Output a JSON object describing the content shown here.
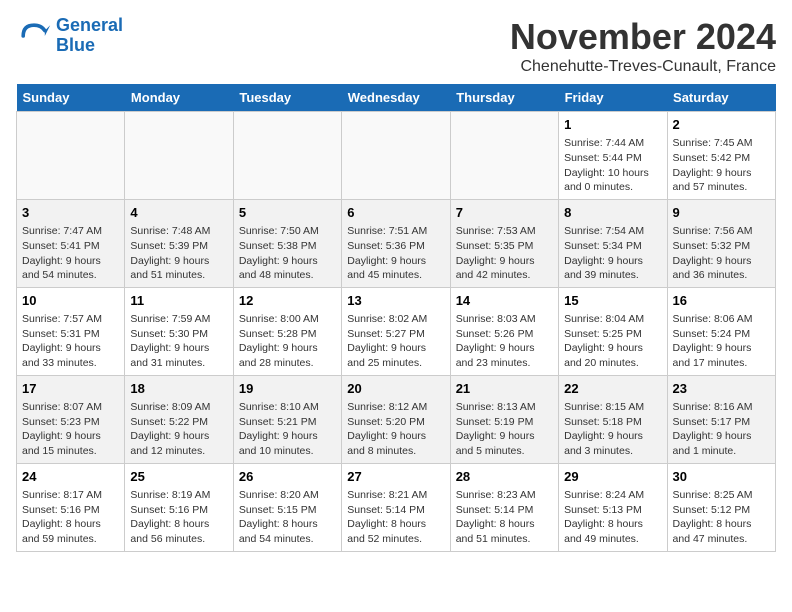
{
  "header": {
    "logo_line1": "General",
    "logo_line2": "Blue",
    "month": "November 2024",
    "location": "Chenehutte-Treves-Cunault, France"
  },
  "weekdays": [
    "Sunday",
    "Monday",
    "Tuesday",
    "Wednesday",
    "Thursday",
    "Friday",
    "Saturday"
  ],
  "weeks": [
    [
      {
        "day": "",
        "info": ""
      },
      {
        "day": "",
        "info": ""
      },
      {
        "day": "",
        "info": ""
      },
      {
        "day": "",
        "info": ""
      },
      {
        "day": "",
        "info": ""
      },
      {
        "day": "1",
        "info": "Sunrise: 7:44 AM\nSunset: 5:44 PM\nDaylight: 10 hours\nand 0 minutes."
      },
      {
        "day": "2",
        "info": "Sunrise: 7:45 AM\nSunset: 5:42 PM\nDaylight: 9 hours\nand 57 minutes."
      }
    ],
    [
      {
        "day": "3",
        "info": "Sunrise: 7:47 AM\nSunset: 5:41 PM\nDaylight: 9 hours\nand 54 minutes."
      },
      {
        "day": "4",
        "info": "Sunrise: 7:48 AM\nSunset: 5:39 PM\nDaylight: 9 hours\nand 51 minutes."
      },
      {
        "day": "5",
        "info": "Sunrise: 7:50 AM\nSunset: 5:38 PM\nDaylight: 9 hours\nand 48 minutes."
      },
      {
        "day": "6",
        "info": "Sunrise: 7:51 AM\nSunset: 5:36 PM\nDaylight: 9 hours\nand 45 minutes."
      },
      {
        "day": "7",
        "info": "Sunrise: 7:53 AM\nSunset: 5:35 PM\nDaylight: 9 hours\nand 42 minutes."
      },
      {
        "day": "8",
        "info": "Sunrise: 7:54 AM\nSunset: 5:34 PM\nDaylight: 9 hours\nand 39 minutes."
      },
      {
        "day": "9",
        "info": "Sunrise: 7:56 AM\nSunset: 5:32 PM\nDaylight: 9 hours\nand 36 minutes."
      }
    ],
    [
      {
        "day": "10",
        "info": "Sunrise: 7:57 AM\nSunset: 5:31 PM\nDaylight: 9 hours\nand 33 minutes."
      },
      {
        "day": "11",
        "info": "Sunrise: 7:59 AM\nSunset: 5:30 PM\nDaylight: 9 hours\nand 31 minutes."
      },
      {
        "day": "12",
        "info": "Sunrise: 8:00 AM\nSunset: 5:28 PM\nDaylight: 9 hours\nand 28 minutes."
      },
      {
        "day": "13",
        "info": "Sunrise: 8:02 AM\nSunset: 5:27 PM\nDaylight: 9 hours\nand 25 minutes."
      },
      {
        "day": "14",
        "info": "Sunrise: 8:03 AM\nSunset: 5:26 PM\nDaylight: 9 hours\nand 23 minutes."
      },
      {
        "day": "15",
        "info": "Sunrise: 8:04 AM\nSunset: 5:25 PM\nDaylight: 9 hours\nand 20 minutes."
      },
      {
        "day": "16",
        "info": "Sunrise: 8:06 AM\nSunset: 5:24 PM\nDaylight: 9 hours\nand 17 minutes."
      }
    ],
    [
      {
        "day": "17",
        "info": "Sunrise: 8:07 AM\nSunset: 5:23 PM\nDaylight: 9 hours\nand 15 minutes."
      },
      {
        "day": "18",
        "info": "Sunrise: 8:09 AM\nSunset: 5:22 PM\nDaylight: 9 hours\nand 12 minutes."
      },
      {
        "day": "19",
        "info": "Sunrise: 8:10 AM\nSunset: 5:21 PM\nDaylight: 9 hours\nand 10 minutes."
      },
      {
        "day": "20",
        "info": "Sunrise: 8:12 AM\nSunset: 5:20 PM\nDaylight: 9 hours\nand 8 minutes."
      },
      {
        "day": "21",
        "info": "Sunrise: 8:13 AM\nSunset: 5:19 PM\nDaylight: 9 hours\nand 5 minutes."
      },
      {
        "day": "22",
        "info": "Sunrise: 8:15 AM\nSunset: 5:18 PM\nDaylight: 9 hours\nand 3 minutes."
      },
      {
        "day": "23",
        "info": "Sunrise: 8:16 AM\nSunset: 5:17 PM\nDaylight: 9 hours\nand 1 minute."
      }
    ],
    [
      {
        "day": "24",
        "info": "Sunrise: 8:17 AM\nSunset: 5:16 PM\nDaylight: 8 hours\nand 59 minutes."
      },
      {
        "day": "25",
        "info": "Sunrise: 8:19 AM\nSunset: 5:16 PM\nDaylight: 8 hours\nand 56 minutes."
      },
      {
        "day": "26",
        "info": "Sunrise: 8:20 AM\nSunset: 5:15 PM\nDaylight: 8 hours\nand 54 minutes."
      },
      {
        "day": "27",
        "info": "Sunrise: 8:21 AM\nSunset: 5:14 PM\nDaylight: 8 hours\nand 52 minutes."
      },
      {
        "day": "28",
        "info": "Sunrise: 8:23 AM\nSunset: 5:14 PM\nDaylight: 8 hours\nand 51 minutes."
      },
      {
        "day": "29",
        "info": "Sunrise: 8:24 AM\nSunset: 5:13 PM\nDaylight: 8 hours\nand 49 minutes."
      },
      {
        "day": "30",
        "info": "Sunrise: 8:25 AM\nSunset: 5:12 PM\nDaylight: 8 hours\nand 47 minutes."
      }
    ]
  ]
}
